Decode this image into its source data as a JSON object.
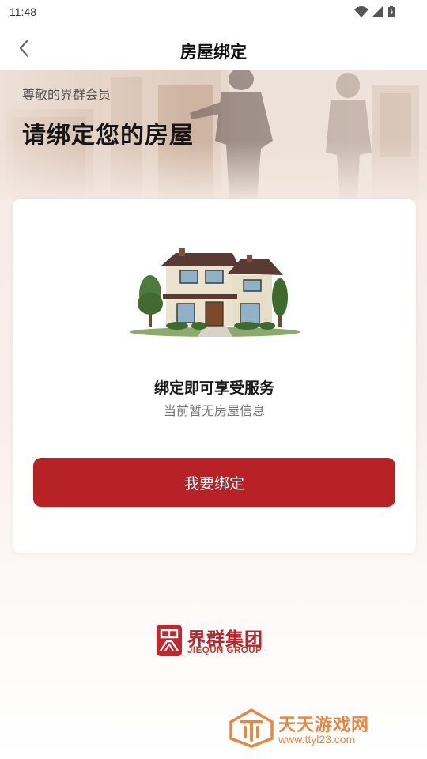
{
  "status_bar": {
    "time": "11:48",
    "icons": [
      "wifi-icon",
      "signal-icon",
      "battery-icon"
    ]
  },
  "header": {
    "title": "房屋绑定",
    "back_icon": "chevron-left-icon"
  },
  "hero": {
    "greeting": "尊敬的界群会员",
    "headline": "请绑定您的房屋"
  },
  "card": {
    "illustration": "house-icon",
    "title": "绑定即可享受服务",
    "subtitle": "当前暂无房屋信息",
    "button_label": "我要绑定"
  },
  "brand": {
    "name_cn": "界群集团",
    "name_en": "JIEQUN GROUP"
  },
  "watermark": {
    "name_cn": "天天游戏网",
    "url": "www.ttyl23.com"
  },
  "colors": {
    "accent": "#b72226",
    "brand": "#b8262b",
    "watermark": "#e9863f"
  }
}
